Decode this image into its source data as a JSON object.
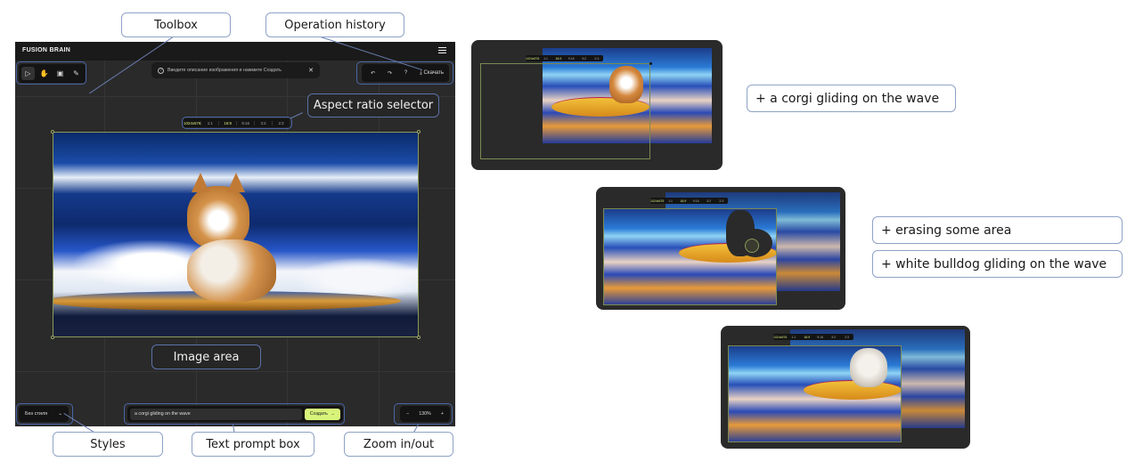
{
  "callouts": {
    "toolbox": "Toolbox",
    "operation_history": "Operation history",
    "aspect_ratio_selector": "Aspect ratio selector",
    "image_area": "Image area",
    "styles": "Styles",
    "text_prompt_box": "Text prompt box",
    "zoom_in_out": "Zoom in/out"
  },
  "app": {
    "brand": "FUSION BRAIN",
    "menu_icon": "hamburger-icon",
    "toolbox": {
      "tools": [
        {
          "name": "select",
          "icon": "cursor-arrow-icon",
          "glyph": "▷",
          "active": true
        },
        {
          "name": "hand",
          "icon": "hand-icon",
          "glyph": "✋",
          "active": false
        },
        {
          "name": "image",
          "icon": "image-icon",
          "glyph": "▣",
          "active": false
        },
        {
          "name": "eraser",
          "icon": "eraser-icon",
          "glyph": "✎",
          "active": false
        }
      ]
    },
    "hint": {
      "icon": "question-icon",
      "text": "Введите описание изображения и нажмите Создать",
      "close_icon": "close-icon"
    },
    "history": {
      "undo_glyph": "↶",
      "redo_glyph": "↷",
      "help_glyph": "?",
      "download_glyph": "⤓",
      "download_label": "Скачать"
    },
    "aspect_ratios": {
      "resolution": "1024x576",
      "options": [
        "1:1",
        "16:9",
        "9:16",
        "3:2",
        "2:3"
      ],
      "selected": "16:9"
    },
    "style_select": {
      "value": "Без стиля",
      "chevron": "chevron-down-icon"
    },
    "prompt": {
      "value": "a corgi gliding on the wave",
      "create_label": "Создать",
      "create_arrow": "→"
    },
    "zoom": {
      "minus": "−",
      "value": "130%",
      "plus": "+"
    }
  },
  "steps": [
    {
      "label": "+ a corgi gliding on the wave"
    },
    {
      "label": "+ erasing some area"
    },
    {
      "label": "+ white bulldog gliding on the wave"
    }
  ],
  "colors": {
    "canvas": "#2a2a2a",
    "header": "#1a1a1a",
    "accent": "#d8f47a",
    "callout_border": "#8ea2c6"
  }
}
